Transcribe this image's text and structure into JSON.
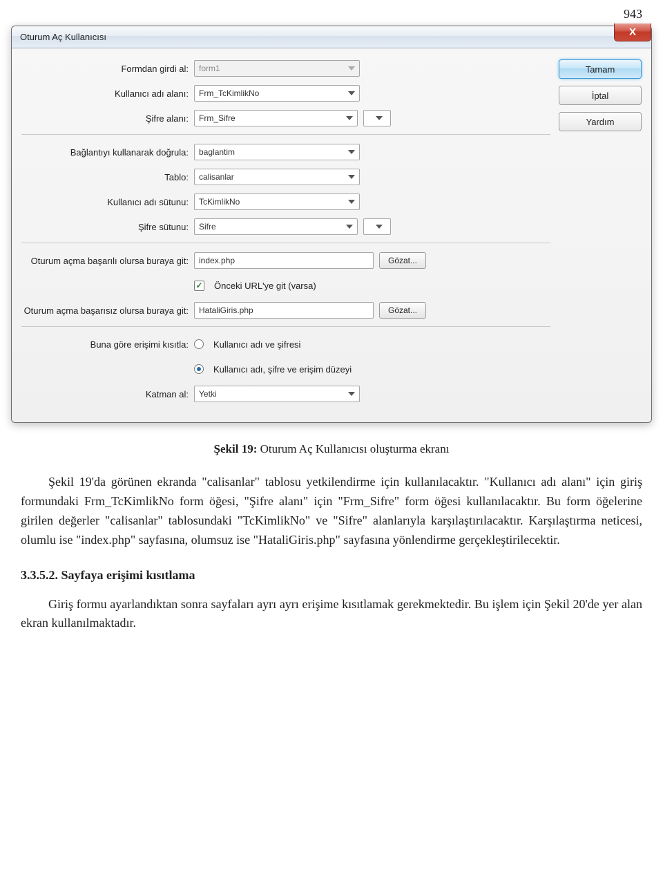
{
  "page_number": "943",
  "dialog": {
    "title": "Oturum Aç Kullanıcısı",
    "buttons": {
      "ok": "Tamam",
      "cancel": "İptal",
      "help": "Yardım"
    },
    "browse": "Gözat...",
    "labels": {
      "form_source": "Formdan girdi al:",
      "user_field": "Kullanıcı adı alanı:",
      "pass_field": "Şifre alanı:",
      "conn": "Bağlantıyı kullanarak doğrula:",
      "table": "Tablo:",
      "user_col": "Kullanıcı adı sütunu:",
      "pass_col": "Şifre sütunu:",
      "success": "Oturum açma başarılı olursa buraya git:",
      "prev_url": "Önceki URL'ye git (varsa)",
      "fail": "Oturum açma başarısız olursa buraya git:",
      "restrict": "Buna göre erişimi kısıtla:",
      "radio1": "Kullanıcı adı ve şifresi",
      "radio2": "Kullanıcı adı, şifre ve erişim düzeyi",
      "level": "Katman al:"
    },
    "values": {
      "form_source": "form1",
      "user_field": "Frm_TcKimlikNo",
      "pass_field": "Frm_Sifre",
      "conn": "baglantim",
      "table": "calisanlar",
      "user_col": "TcKimlikNo",
      "pass_col": "Sifre",
      "success": "index.php",
      "fail": "HataliGiris.php",
      "level": "Yetki",
      "prev_url_checked": true,
      "restrict_selected": "radio2"
    }
  },
  "caption_prefix": "Şekil 19:",
  "caption_text": " Oturum Aç Kullanıcısı oluşturma ekranı",
  "para1": "Şekil 19'da görünen ekranda \"calisanlar\" tablosu yetkilendirme için kullanılacaktır. \"Kullanıcı adı alanı\" için giriş formundaki Frm_TcKimlikNo form öğesi, \"Şifre alanı\" için \"Frm_Sifre\" form öğesi kullanılacaktır. Bu form öğelerine girilen değerler \"calisanlar\" tablosundaki \"TcKimlikNo\" ve \"Sifre\" alanlarıyla karşılaştırılacaktır. Karşılaştırma neticesi, olumlu ise \"index.php\" sayfasına, olumsuz ise \"HataliGiris.php\" sayfasına yönlendirme gerçekleştirilecektir.",
  "heading": "3.3.5.2. Sayfaya erişimi kısıtlama",
  "para2": "Giriş formu ayarlandıktan sonra sayfaları ayrı ayrı erişime kısıtlamak gerekmektedir. Bu işlem için Şekil 20'de yer alan ekran kullanılmaktadır."
}
